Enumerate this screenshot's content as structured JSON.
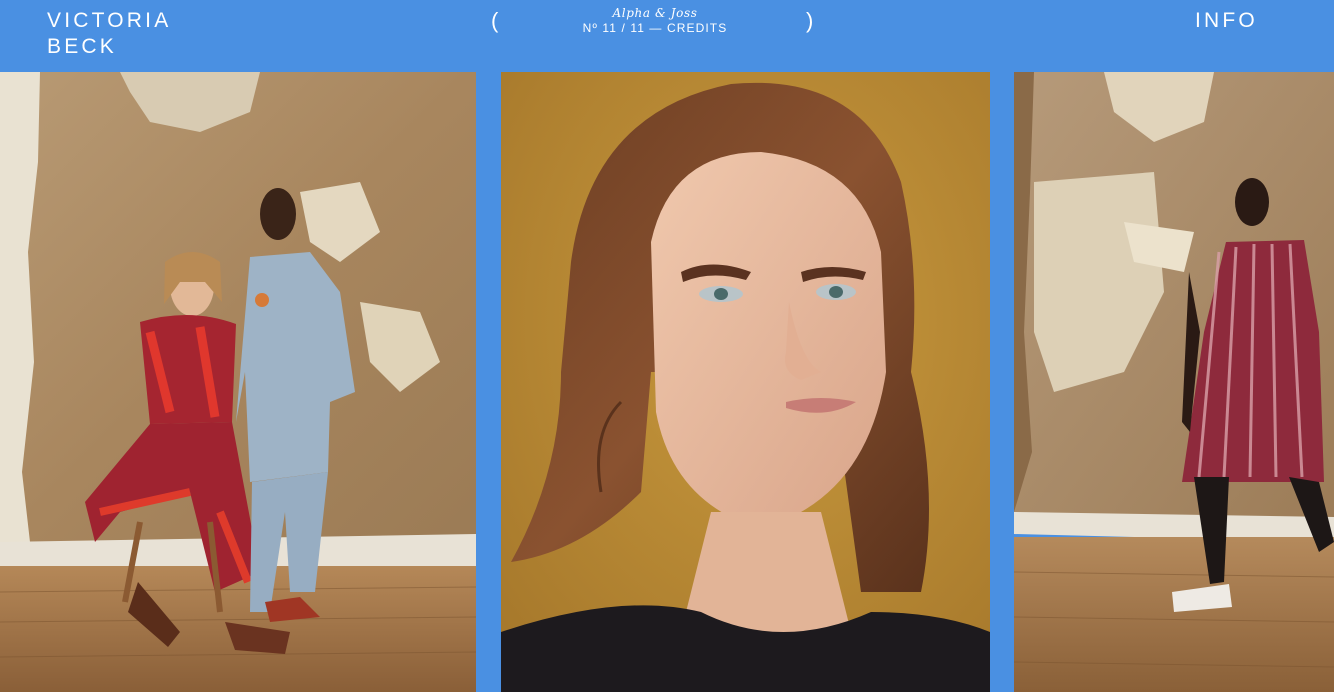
{
  "brand": {
    "line1": "VICTORIA",
    "line2": "BECK"
  },
  "gallery": {
    "paren_open": "(",
    "paren_close": ")",
    "series_title": "Alpha & Joss",
    "counter": "Nº 11 / 11",
    "separator": " — ",
    "credits_label": "CREDITS"
  },
  "nav": {
    "info_label": "INFO"
  },
  "colors": {
    "accent": "#4a90e2",
    "text": "#ffffff"
  },
  "photos": [
    {
      "subject": "two models posing in a room with plaster wall and wooden floor"
    },
    {
      "subject": "close-up portrait of a model with long hair and glitter eye makeup on mustard background"
    },
    {
      "subject": "model standing in a striped dress in a room with plaster wall"
    }
  ]
}
